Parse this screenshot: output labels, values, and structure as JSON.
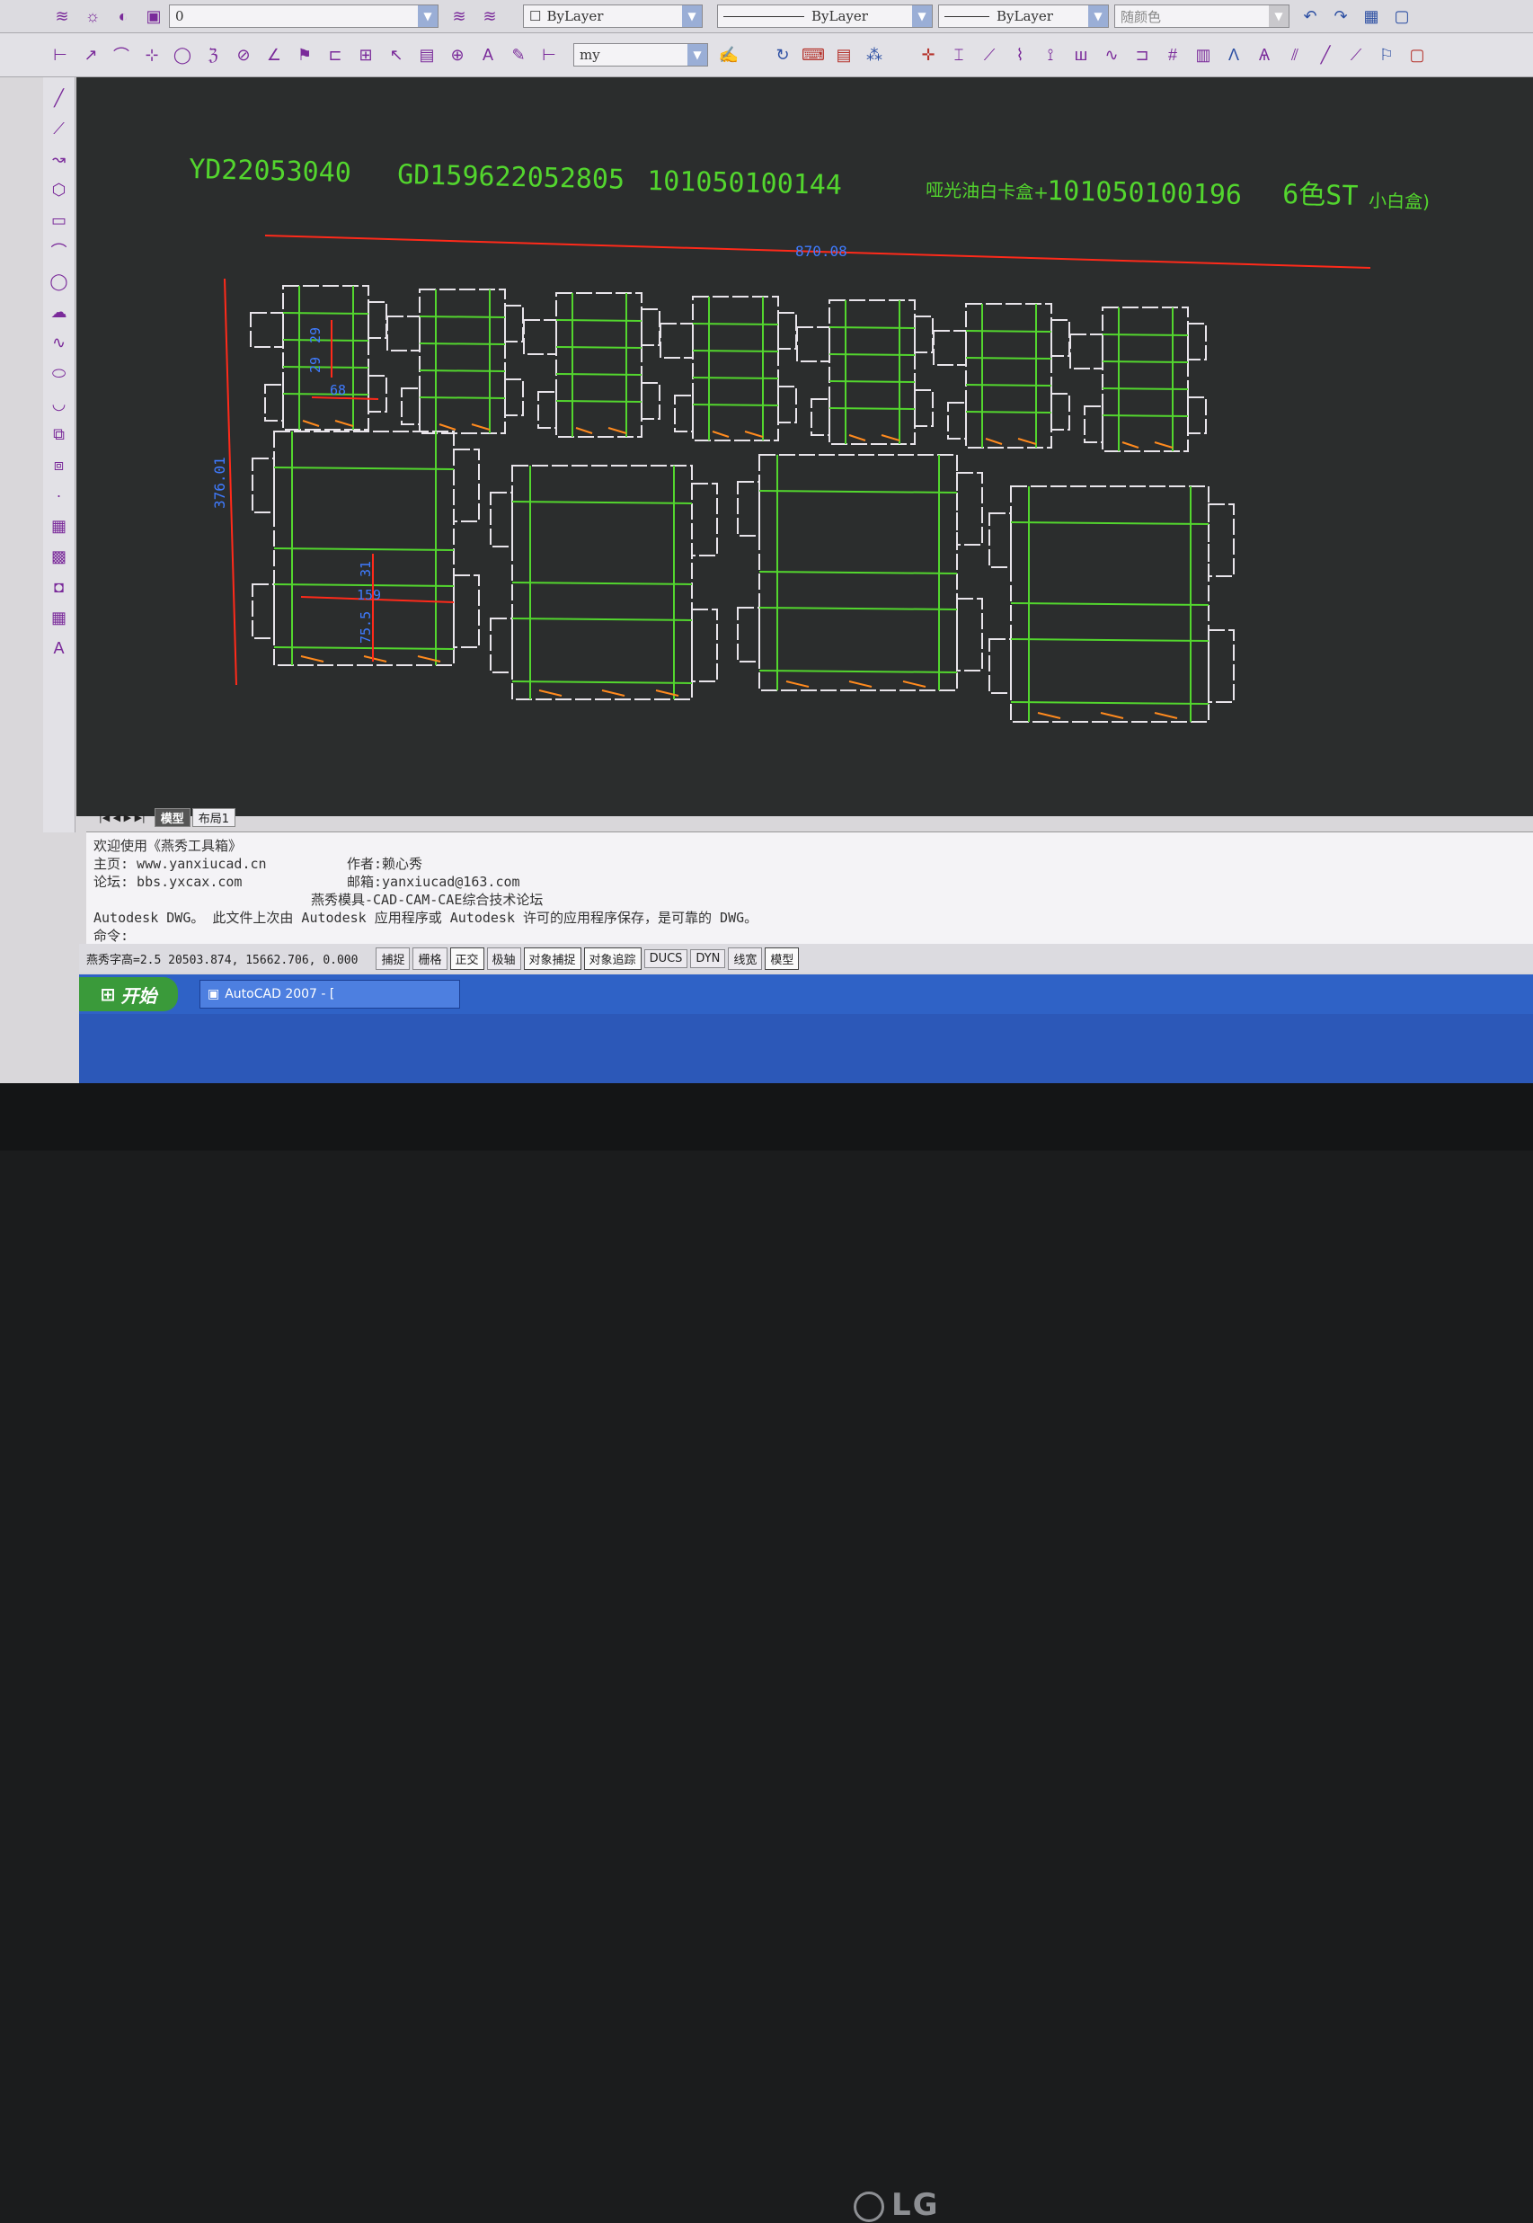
{
  "toolbar1": {
    "layer_value": "0",
    "color_combo": "ByLayer",
    "linetype_combo": "ByLayer",
    "lineweight_combo": "ByLayer",
    "plotstyle_combo": "随颜色"
  },
  "toolbar2": {
    "dimstyle_combo": "my"
  },
  "drawing": {
    "header_text_1": "YD22053040",
    "header_text_2": "GD159622052805",
    "header_text_3": "101050100144",
    "header_text_4": "哑光油白卡盒+",
    "header_text_5": "101050100196",
    "header_text_6": "6色ST",
    "header_text_7": "小白盒)",
    "dim_total_width": "870.08",
    "dim_total_height": "376.01",
    "dim_small_a": "29",
    "dim_small_b": "29",
    "dim_small_width": "68",
    "dim_large_a": "31",
    "dim_large_width": "159",
    "dim_large_b": "75.5",
    "colors": {
      "background": "#2b2d2d",
      "cut_line": "#e8e4ea",
      "crease_line": "#53d62e",
      "dimension": "#ff2a1a",
      "dim_text": "#3f7bff",
      "glue_mark": "#ff8a1e"
    }
  },
  "tabs": {
    "model": "模型",
    "layout1": "布局1"
  },
  "command": {
    "line1": "欢迎使用《燕秀工具箱》",
    "line2_left": "主页: www.yanxiucad.cn",
    "line2_right": "作者:赖心秀",
    "line3_left": "论坛: bbs.yxcax.com",
    "line3_right": "邮箱:yanxiucad@163.com",
    "line4": "燕秀模具-CAD-CAM-CAE综合技术论坛",
    "line5": "Autodesk DWG。  此文件上次由 Autodesk 应用程序或 Autodesk 许可的应用程序保存，是可靠的 DWG。",
    "prompt": "命令:"
  },
  "status": {
    "coords": "燕秀字高=2.5  20503.874, 15662.706, 0.000",
    "buttons": [
      "捕捉",
      "栅格",
      "正交",
      "极轴",
      "对象捕捉",
      "对象追踪",
      "DUCS",
      "DYN",
      "线宽",
      "模型"
    ]
  },
  "taskbar": {
    "start": "开始",
    "task": "AutoCAD 2007 - ["
  },
  "monitor": {
    "brand": "LG"
  }
}
